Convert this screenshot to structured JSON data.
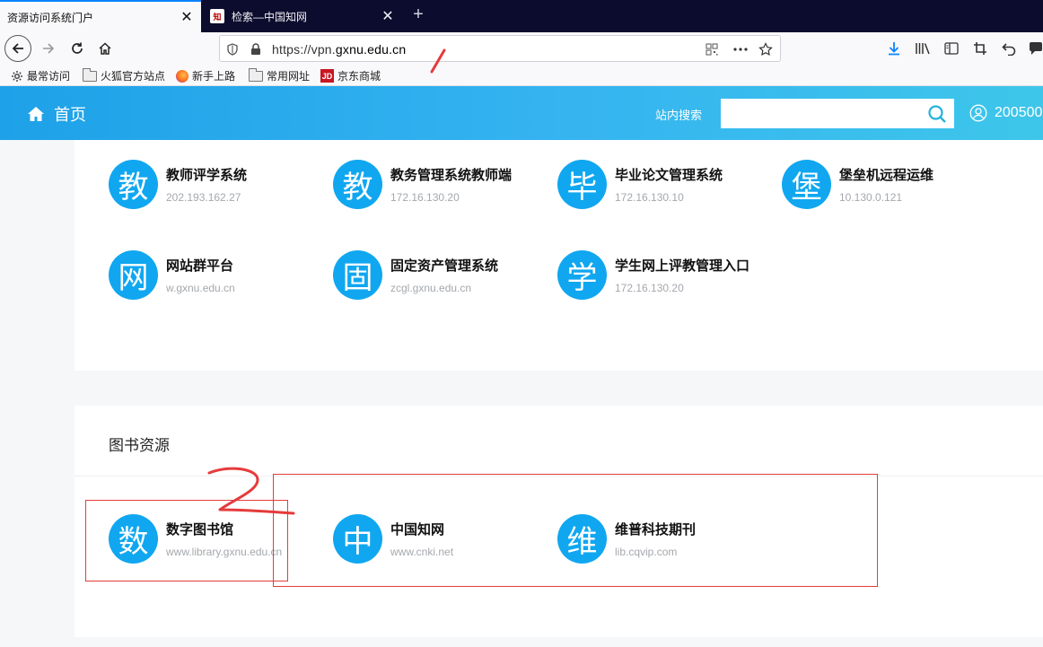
{
  "browser": {
    "tabs": [
      {
        "title": "资源访问系统门户",
        "active": true
      },
      {
        "title": "检索—中国知网",
        "active": false,
        "favicon_text": "知"
      }
    ],
    "url_prefix": "https://vpn.",
    "url_domain": "gxnu.edu.cn",
    "bookmarks": [
      "最常访问",
      "火狐官方站点",
      "新手上路",
      "常用网址",
      "京东商城"
    ],
    "jd_icon_text": "JD"
  },
  "header": {
    "home_label": "首页",
    "search_label": "站内搜索",
    "search_value": "",
    "user_id": "200500"
  },
  "systems": [
    {
      "glyph": "教",
      "name": "教师评学系统",
      "address": "202.193.162.27"
    },
    {
      "glyph": "教",
      "name": "教务管理系统教师端",
      "address": "172.16.130.20"
    },
    {
      "glyph": "毕",
      "name": "毕业论文管理系统",
      "address": "172.16.130.10"
    },
    {
      "glyph": "堡",
      "name": "堡垒机远程运维",
      "address": "10.130.0.121"
    },
    {
      "glyph": "网",
      "name": "网站群平台",
      "address": "w.gxnu.edu.cn"
    },
    {
      "glyph": "固",
      "name": "固定资产管理系统",
      "address": "zcgl.gxnu.edu.cn"
    },
    {
      "glyph": "学",
      "name": "学生网上评教管理入口",
      "address": "172.16.130.20"
    }
  ],
  "library": {
    "title": "图书资源",
    "items": [
      {
        "glyph": "数",
        "name": "数字图书馆",
        "address": "www.library.gxnu.edu.cn"
      },
      {
        "glyph": "中",
        "name": "中国知网",
        "address": "www.cnki.net"
      },
      {
        "glyph": "维",
        "name": "维普科技期刊",
        "address": "lib.cqvip.com"
      }
    ]
  },
  "colors": {
    "tabbar": "#0c0c2e",
    "accent": "#10a7f0",
    "header_start": "#1ea1e8",
    "header_end": "#3ec6ea",
    "annotation": "#e53b3b"
  }
}
